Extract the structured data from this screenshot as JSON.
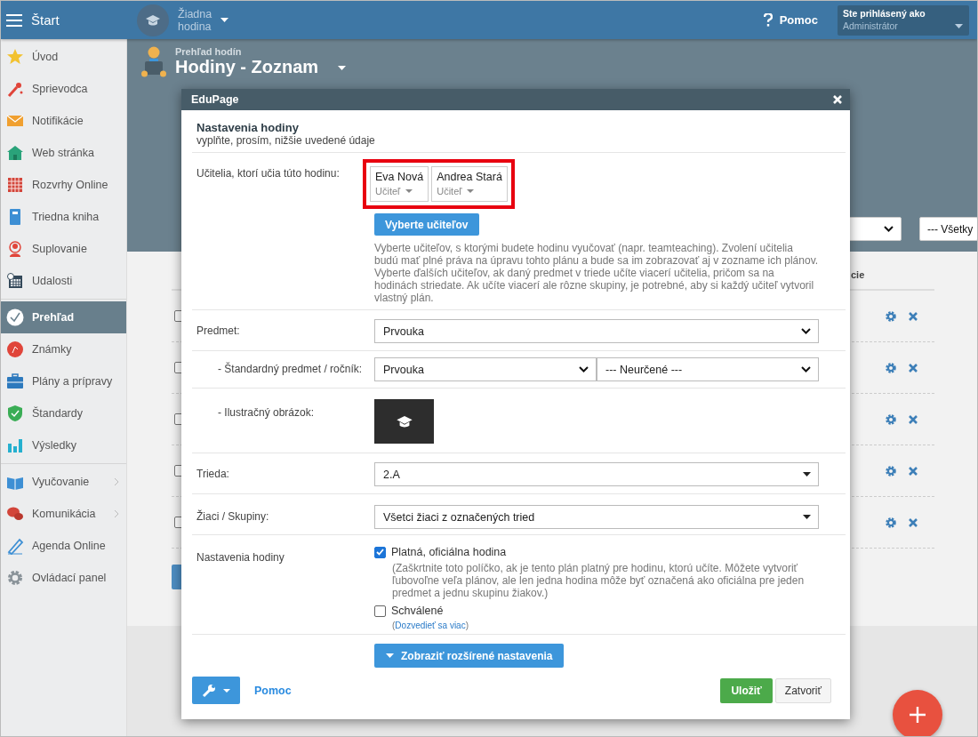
{
  "topbar": {
    "menu_label": "Štart",
    "lesson": [
      "Žiadna",
      "hodina"
    ],
    "help": "Pomoc",
    "user": {
      "caption": "Ste prihlásený ako",
      "name": "Administrátor"
    }
  },
  "sidebar": {
    "groups": [
      [
        {
          "label": "Úvod",
          "selected": false,
          "submenu": false
        },
        {
          "label": "Sprievodca",
          "selected": false,
          "submenu": false
        },
        {
          "label": "Notifikácie",
          "selected": false,
          "submenu": false
        },
        {
          "label": "Web stránka",
          "selected": false,
          "submenu": false
        },
        {
          "label": "Rozvrhy Online",
          "selected": false,
          "submenu": false
        },
        {
          "label": "Triedna kniha",
          "selected": false,
          "submenu": false
        },
        {
          "label": "Suplovanie",
          "selected": false,
          "submenu": false
        },
        {
          "label": "Udalosti",
          "selected": false,
          "submenu": false
        }
      ],
      [
        {
          "label": "Prehľad",
          "selected": true,
          "submenu": false
        },
        {
          "label": "Známky",
          "selected": false,
          "submenu": false
        },
        {
          "label": "Plány a prípravy",
          "selected": false,
          "submenu": false
        },
        {
          "label": "Štandardy",
          "selected": false,
          "submenu": false
        },
        {
          "label": "Výsledky",
          "selected": false,
          "submenu": false
        }
      ],
      [
        {
          "label": "Vyučovanie",
          "selected": false,
          "submenu": true
        },
        {
          "label": "Komunikácia",
          "selected": false,
          "submenu": true
        },
        {
          "label": "Agenda Online",
          "selected": false,
          "submenu": false
        },
        {
          "label": "Ovládací panel",
          "selected": false,
          "submenu": false
        }
      ]
    ]
  },
  "page_header": {
    "breadcrumb": "Prehľad hodín",
    "title": "Hodiny - Zoznam",
    "filter": "--- Všetky"
  },
  "table": {
    "column_header": "cie",
    "rows": [
      {
        "checked": false
      },
      {
        "checked": false
      },
      {
        "checked": false
      },
      {
        "checked": false
      },
      {
        "checked": false
      }
    ]
  },
  "dialog": {
    "title": "EduPage",
    "heading": "Nastavenia hodiny",
    "subheading": "vyplňte, prosím, nižšie uvedené údaje",
    "teachers": {
      "label": "Učitelia, ktorí učia túto hodinu:",
      "highlighted": true,
      "items": [
        {
          "name": "Eva Nová",
          "role": "Učiteľ"
        },
        {
          "name": "Andrea Stará",
          "role": "Učiteľ"
        }
      ],
      "button": "Vyberte učiteľov",
      "help": "Vyberte učiteľov, s ktorými budete hodinu vyučovať (napr. teamteaching). Zvolení učitelia budú mať plné práva na úpravu tohto plánu a bude sa im zobrazovať aj v zozname ich plánov. Vyberte ďalších učiteľov, ak daný predmet v triede učíte viacerí učitelia, pričom sa na hodinách striedate. Ak učíte viacerí ale rôzne skupiny, je potrebné, aby si každý učiteľ vytvoril vlastný plán."
    },
    "subject": {
      "label": "Predmet:",
      "value": "Prvouka"
    },
    "standard": {
      "label": "- Štandardný predmet / ročník:",
      "subject": "Prvouka",
      "grade": "--- Neurčené ---"
    },
    "image": {
      "label": "- Ilustračný obrázok:"
    },
    "class": {
      "label": "Trieda:",
      "value": "2.A"
    },
    "students": {
      "label": "Žiaci / Skupiny:",
      "value": "Všetci žiaci z označených tried"
    },
    "settings": {
      "label": "Nastavenia hodiny",
      "options": [
        {
          "label": "Platná, oficiálna hodina",
          "checked": true,
          "note": "(Zaškrtnite toto políčko, ak je tento plán platný pre hodinu, ktorú učíte. Môžete vytvoriť ľubovoľne veľa plánov, ale len jedna hodina môže byť označená ako oficiálna pre jeden predmet a jednu skupinu žiakov.)"
        },
        {
          "label": "Schválené",
          "checked": false,
          "link": {
            "before": "(",
            "text": "Dozvedieť sa viac",
            "after": ")"
          }
        }
      ]
    },
    "advanced_button": "Zobraziť rozšírené nastavenia",
    "footer": {
      "help": "Pomoc",
      "save": "Uložiť",
      "close": "Zatvoriť"
    }
  }
}
